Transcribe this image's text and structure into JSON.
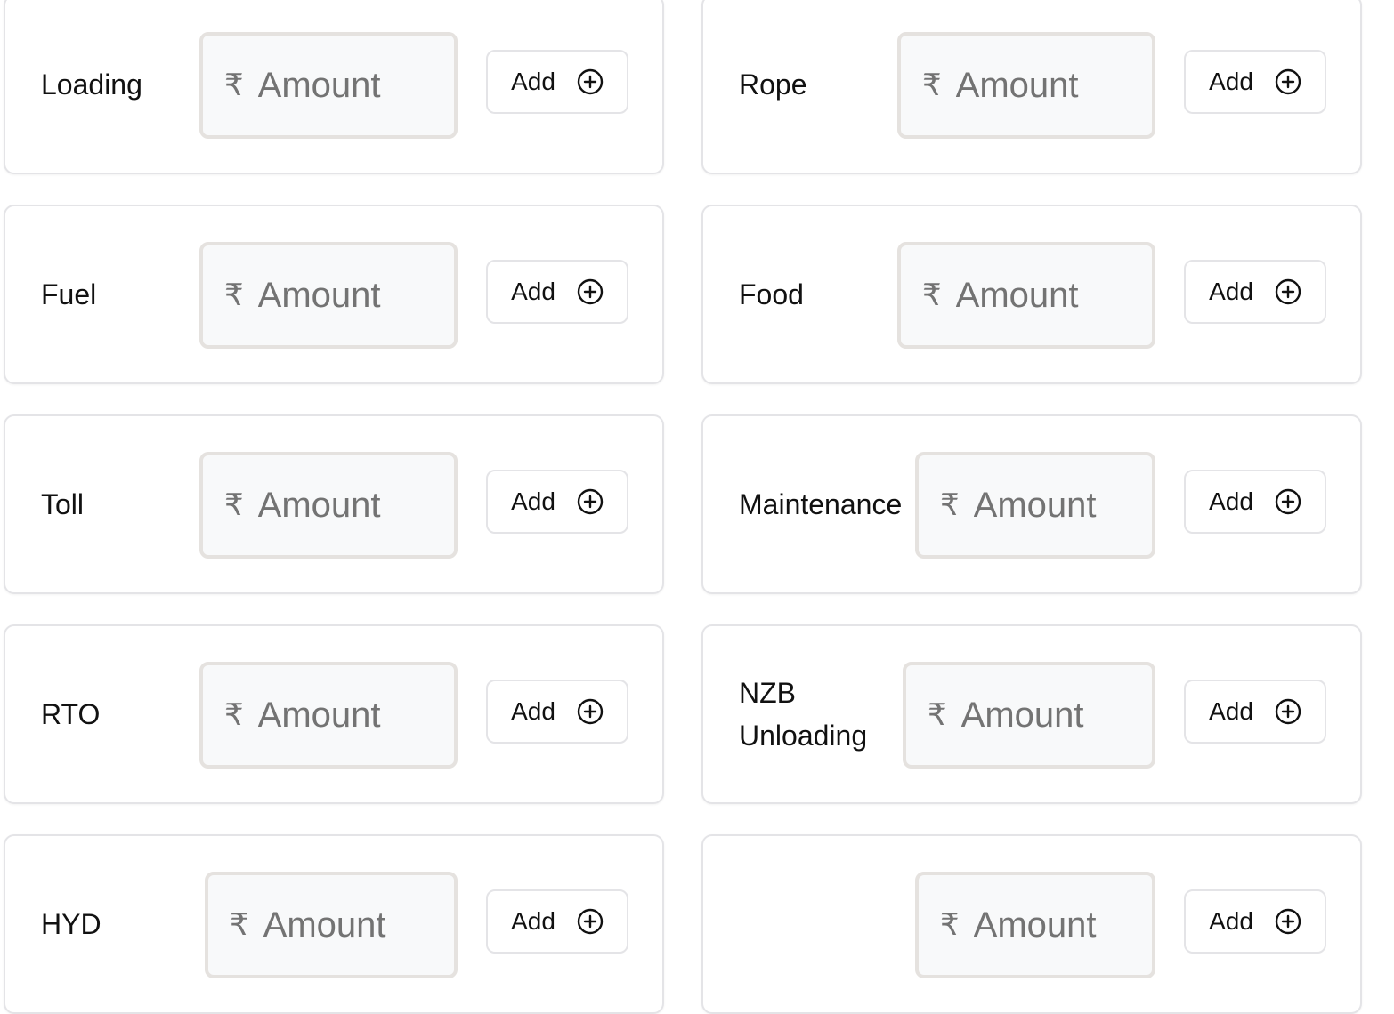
{
  "cards": [
    {
      "label": "Loading",
      "placeholder": "Amount",
      "currency": "₹",
      "button": "Add"
    },
    {
      "label": "Rope",
      "placeholder": "Amount",
      "currency": "₹",
      "button": "Add"
    },
    {
      "label": "Fuel",
      "placeholder": "Amount",
      "currency": "₹",
      "button": "Add"
    },
    {
      "label": "Food",
      "placeholder": "Amount",
      "currency": "₹",
      "button": "Add"
    },
    {
      "label": "Toll",
      "placeholder": "Amount",
      "currency": "₹",
      "button": "Add"
    },
    {
      "label": "Maintenance",
      "placeholder": "Amount",
      "currency": "₹",
      "button": "Add"
    },
    {
      "label": "RTO",
      "placeholder": "Amount",
      "currency": "₹",
      "button": "Add"
    },
    {
      "label": "NZB Unloading",
      "placeholder": "Amount",
      "currency": "₹",
      "button": "Add"
    },
    {
      "label": "HYD",
      "placeholder": "Amount",
      "currency": "₹",
      "button": "Add"
    },
    {
      "label": "",
      "placeholder": "Amount",
      "currency": "₹",
      "button": "Add"
    }
  ],
  "icons": {
    "add": "plus-circle-icon",
    "currency": "rupee-icon"
  },
  "colors": {
    "border": "#e4e4e7",
    "input_bg": "#f8f9fa",
    "placeholder": "#737373"
  }
}
